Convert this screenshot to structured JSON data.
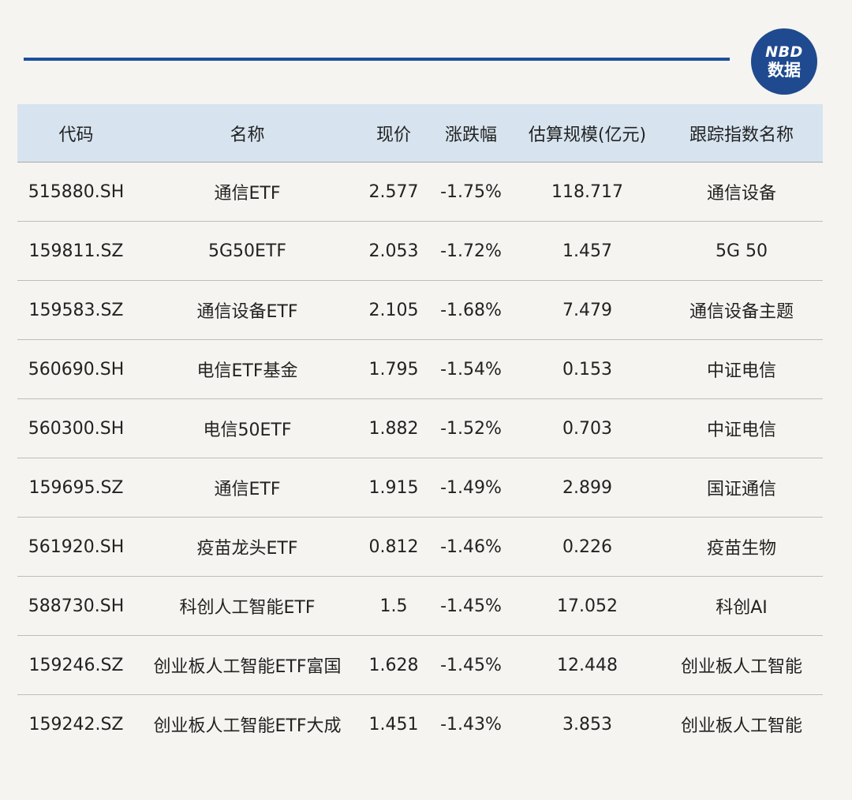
{
  "badge": {
    "line1": "NBD",
    "line2": "数据"
  },
  "table": {
    "headers": [
      "代码",
      "名称",
      "现价",
      "涨跌幅",
      "估算规模(亿元)",
      "跟踪指数名称"
    ],
    "rows": [
      [
        "515880.SH",
        "通信ETF",
        "2.577",
        "-1.75%",
        "118.717",
        "通信设备"
      ],
      [
        "159811.SZ",
        "5G50ETF",
        "2.053",
        "-1.72%",
        "1.457",
        "5G 50"
      ],
      [
        "159583.SZ",
        "通信设备ETF",
        "2.105",
        "-1.68%",
        "7.479",
        "通信设备主题"
      ],
      [
        "560690.SH",
        "电信ETF基金",
        "1.795",
        "-1.54%",
        "0.153",
        "中证电信"
      ],
      [
        "560300.SH",
        "电信50ETF",
        "1.882",
        "-1.52%",
        "0.703",
        "中证电信"
      ],
      [
        "159695.SZ",
        "通信ETF",
        "1.915",
        "-1.49%",
        "2.899",
        "国证通信"
      ],
      [
        "561920.SH",
        "疫苗龙头ETF",
        "0.812",
        "-1.46%",
        "0.226",
        "疫苗生物"
      ],
      [
        "588730.SH",
        "科创人工智能ETF",
        "1.5",
        "-1.45%",
        "17.052",
        "科创AI"
      ],
      [
        "159246.SZ",
        "创业板人工智能ETF富国",
        "1.628",
        "-1.45%",
        "12.448",
        "创业板人工智能"
      ],
      [
        "159242.SZ",
        "创业板人工智能ETF大成",
        "1.451",
        "-1.43%",
        "3.853",
        "创业板人工智能"
      ]
    ]
  }
}
